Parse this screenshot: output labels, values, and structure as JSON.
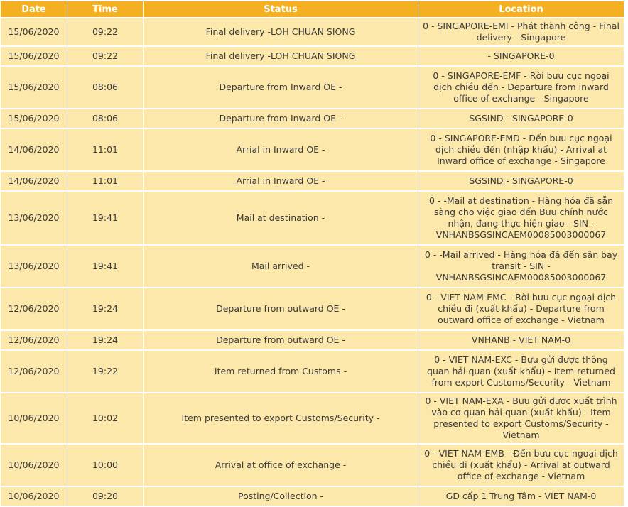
{
  "headers": {
    "date": "Date",
    "time": "Time",
    "status": "Status",
    "location": "Location"
  },
  "rows": [
    {
      "date": "15/06/2020",
      "time": "09:22",
      "status": "Final delivery -LOH CHUAN SIONG",
      "location": "0 - SINGAPORE-EMI - Phát thành công - Final delivery - Singapore"
    },
    {
      "date": "15/06/2020",
      "time": "09:22",
      "status": "Final delivery -LOH CHUAN SIONG",
      "location": "- SINGAPORE-0"
    },
    {
      "date": "15/06/2020",
      "time": "08:06",
      "status": "Departure from Inward OE -",
      "location": "0 - SINGAPORE-EMF - Rời bưu cục ngoại dịch chiều đến - Departure from inward office of exchange - Singapore"
    },
    {
      "date": "15/06/2020",
      "time": "08:06",
      "status": "Departure from Inward OE -",
      "location": "SGSIND - SINGAPORE-0"
    },
    {
      "date": "14/06/2020",
      "time": "11:01",
      "status": "Arrial in Inward OE -",
      "location": "0 - SINGAPORE-EMD - Đến bưu cục ngoại dịch chiều đến (nhập khẩu) - Arrival at Inward office of exchange - Singapore"
    },
    {
      "date": "14/06/2020",
      "time": "11:01",
      "status": "Arrial in Inward OE -",
      "location": "SGSIND - SINGAPORE-0"
    },
    {
      "date": "13/06/2020",
      "time": "19:41",
      "status": "Mail at destination -",
      "location": "0 - -Mail at destination - Hàng hóa đã sẵn sàng cho việc giao đến Bưu chính nước nhận, đang thực hiện giao - SIN - VNHANBSGSINCAEM00085003000067"
    },
    {
      "date": "13/06/2020",
      "time": "19:41",
      "status": "Mail arrived -",
      "location": "0 - -Mail arrived - Hàng hóa đã đến sân bay transit - SIN - VNHANBSGSINCAEM00085003000067"
    },
    {
      "date": "12/06/2020",
      "time": "19:24",
      "status": "Departure from outward OE -",
      "location": "0 - VIET NAM-EMC - Rời bưu cục ngoại dịch chiều đi (xuất khẩu) - Departure from outward office of exchange - Vietnam"
    },
    {
      "date": "12/06/2020",
      "time": "19:24",
      "status": "Departure from outward OE -",
      "location": "VNHANB - VIET NAM-0"
    },
    {
      "date": "12/06/2020",
      "time": "19:22",
      "status": "Item returned from Customs -",
      "location": "0 - VIET NAM-EXC - Bưu gửi được thông quan hải quan (xuất khẩu) - Item returned from export Customs/Security - Vietnam"
    },
    {
      "date": "10/06/2020",
      "time": "10:02",
      "status": "Item presented to export Customs/Security -",
      "location": "0 - VIET NAM-EXA - Bưu gửi được xuất trình vào cơ quan hải quan (xuất khẩu) - Item presented to export Customs/Security - Vietnam"
    },
    {
      "date": "10/06/2020",
      "time": "10:00",
      "status": "Arrival at office of exchange -",
      "location": "0 - VIET NAM-EMB - Đến bưu cục ngoại dịch chiều đi (xuất khẩu) - Arrival at outward office of exchange - Vietnam"
    },
    {
      "date": "10/06/2020",
      "time": "09:20",
      "status": "Posting/Collection -",
      "location": "GD cấp 1 Trung Tâm - VIET NAM-0"
    }
  ]
}
